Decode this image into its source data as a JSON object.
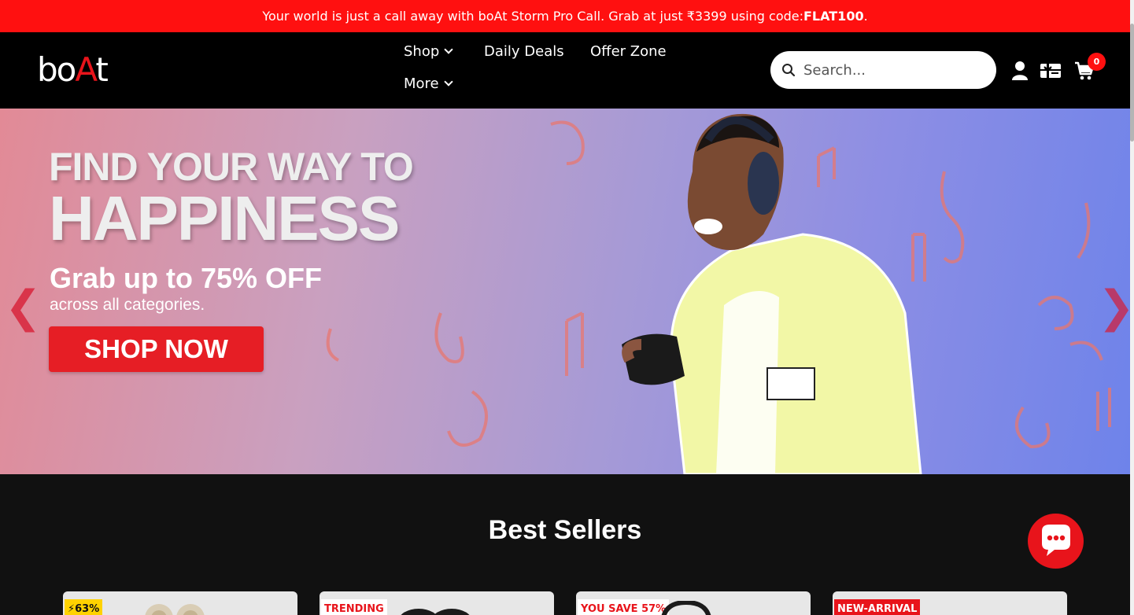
{
  "announcement": {
    "prefix": "Your world is just a call away with boAt Storm Pro Call. Grab at just ₹3399 using code: ",
    "code": "FLAT100",
    "suffix": "."
  },
  "header": {
    "logo_text_1": "bo",
    "logo_text_2": "A",
    "logo_text_3": "t",
    "nav": [
      {
        "label": "Shop",
        "has_dropdown": true
      },
      {
        "label": "Daily Deals",
        "has_dropdown": false
      },
      {
        "label": "Offer Zone",
        "has_dropdown": false
      },
      {
        "label": "More",
        "has_dropdown": true
      }
    ],
    "search_placeholder": "Search...",
    "icons": [
      "search-icon",
      "user-icon",
      "gift-card-icon",
      "cart-icon"
    ],
    "cart_count": "0"
  },
  "hero": {
    "line1": "FIND YOUR WAY TO",
    "line2": "HAPPINESS",
    "offer": "Grab up to 75% OFF",
    "sub": "across all categories.",
    "cta": "SHOP NOW",
    "prev_arrow": "❮",
    "next_arrow": "❯",
    "arrow_color": "#d9344a"
  },
  "best_sellers": {
    "title": "Best Sellers",
    "cards": [
      {
        "badge": "63%",
        "badge_color": "#ffd200",
        "badge_text_color": "#111",
        "badge_icon": "lightning-icon"
      },
      {
        "badge": "TRENDING",
        "badge_color": "#ffffff",
        "badge_text_color": "#e8141b"
      },
      {
        "badge": "YOU SAVE 57%",
        "badge_color": "#ffffff",
        "badge_text_color": "#e8141b"
      },
      {
        "badge": "NEW-ARRIVAL",
        "badge_color": "#e8141b",
        "badge_text_color": "#ffffff"
      }
    ]
  },
  "colors": {
    "brand_red": "#ff1010",
    "header_bg": "#000000",
    "section_bg": "#111111"
  }
}
